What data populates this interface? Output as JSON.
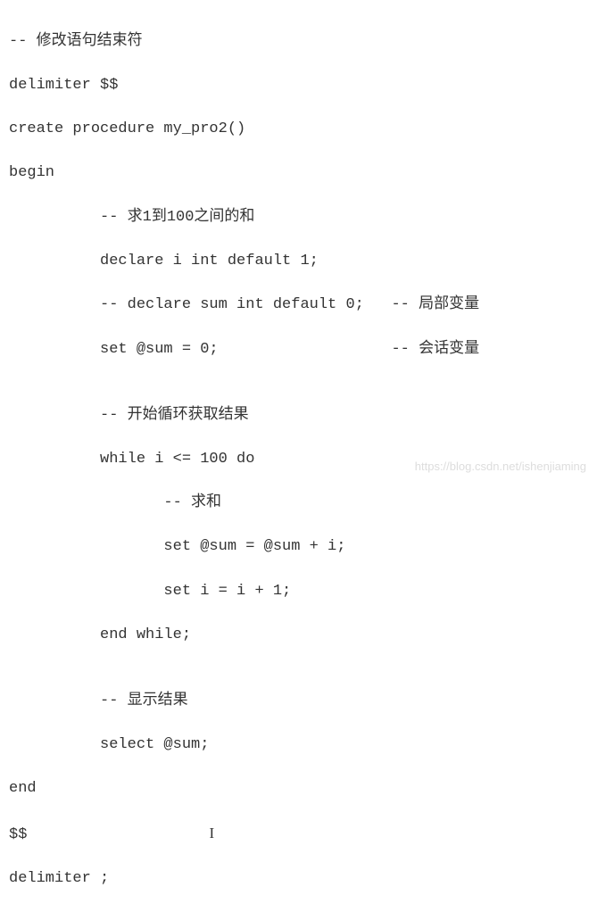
{
  "code": {
    "l1": "-- 修改语句结束符",
    "l2": "delimiter $$",
    "l3": "create procedure my_pro2()",
    "l4": "begin",
    "l5": "          -- 求1到100之间的和",
    "l6": "          declare i int default 1;",
    "l7": "          -- declare sum int default 0;   -- 局部变量",
    "l8": "          set @sum = 0;                   -- 会话变量",
    "l9": "",
    "l10": "          -- 开始循环获取结果",
    "l11": "          while i <= 100 do",
    "l12": "                 -- 求和",
    "l13": "                 set @sum = @sum + i;",
    "l14": "                 set i = i + 1;",
    "l15": "          end while;",
    "l16": "",
    "l17": "          -- 显示结果",
    "l18": "          select @sum;",
    "l19": "end",
    "l20": "$$",
    "l21": "delimiter ;"
  },
  "cursor": "I",
  "watermark": "https://blog.csdn.net/ishenjiaming"
}
